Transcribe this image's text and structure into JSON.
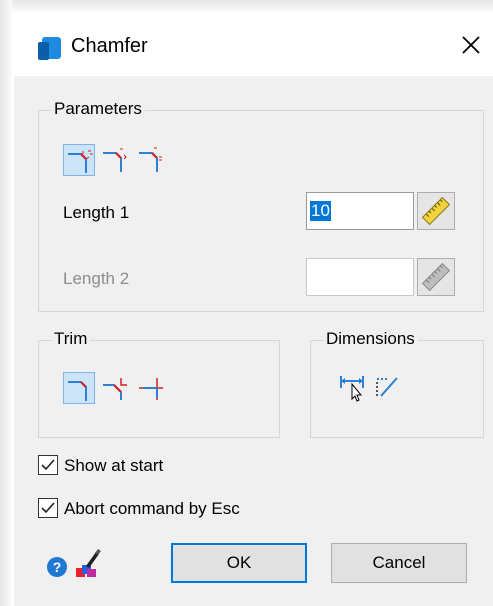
{
  "window": {
    "title": "Chamfer"
  },
  "parameters": {
    "group_label": "Parameters",
    "modes": [
      "chamfer-two-lengths-icon",
      "chamfer-length-angle-icon",
      "chamfer-length-angle-alt-icon"
    ],
    "selected_mode": 0,
    "length1": {
      "label": "Length 1",
      "value": "10",
      "enabled": true
    },
    "length2": {
      "label": "Length 2",
      "value": "",
      "enabled": false
    }
  },
  "trim": {
    "group_label": "Trim",
    "options": [
      "trim-both-icon",
      "trim-first-icon",
      "no-trim-icon"
    ],
    "selected": 0
  },
  "dimensions": {
    "group_label": "Dimensions",
    "icons": [
      "dimension-linear-icon",
      "dimension-chamfer-icon"
    ]
  },
  "options": {
    "show_at_start": {
      "label": "Show at start",
      "checked": true
    },
    "abort_by_esc": {
      "label": "Abort command by Esc",
      "checked": true
    }
  },
  "buttons": {
    "ok": "OK",
    "cancel": "Cancel"
  },
  "colors": {
    "accent": "#0078d7",
    "selected_bg": "#cce4f7",
    "icon_red": "#d42020"
  }
}
